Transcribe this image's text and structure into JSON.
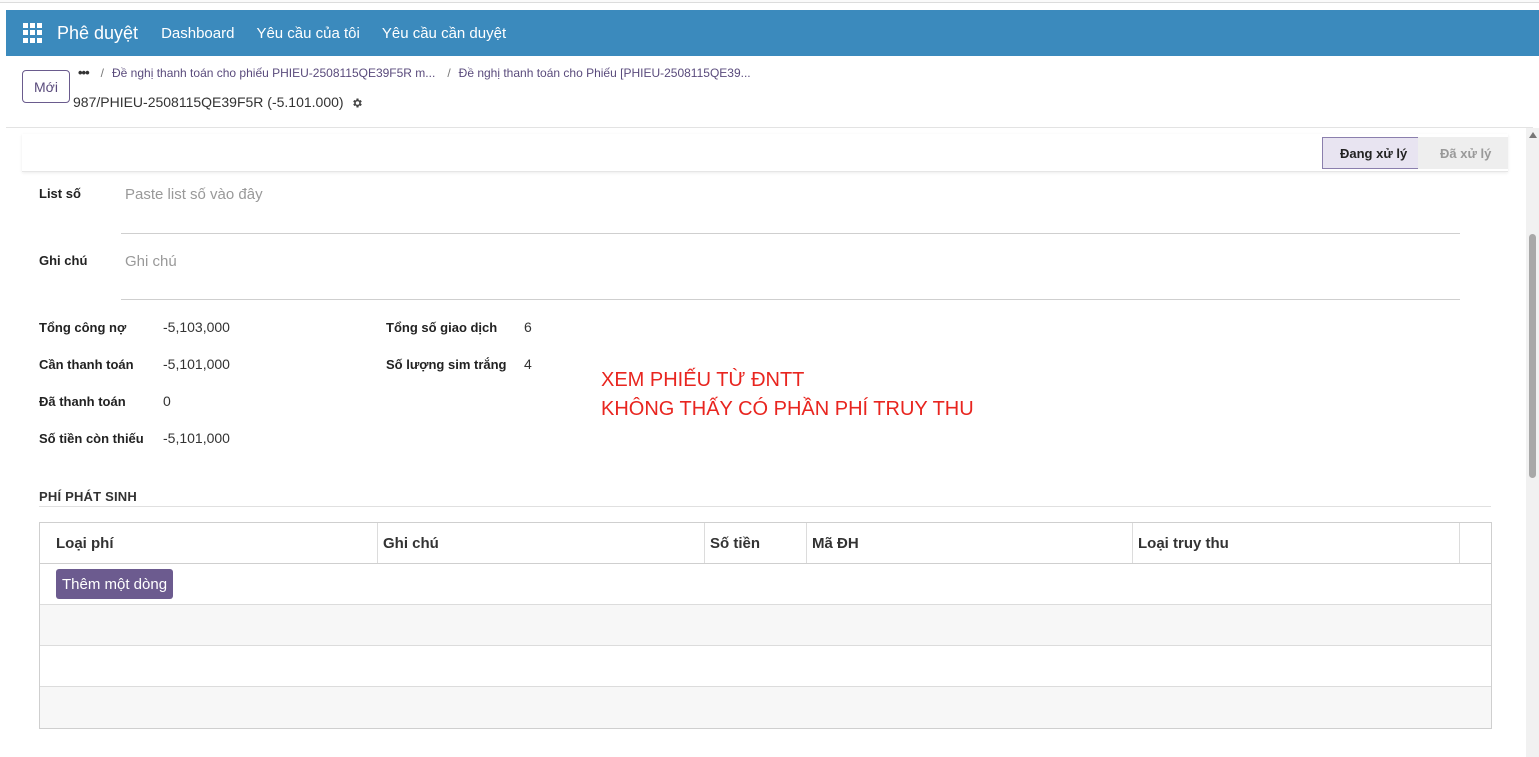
{
  "navbar": {
    "brand": "Phê duyệt",
    "items": [
      "Dashboard",
      "Yêu cầu của tôi",
      "Yêu cầu cần duyệt"
    ]
  },
  "control_panel": {
    "new_button": "Mới",
    "breadcrumbs": [
      "Đề nghị thanh toán cho phiếu PHIEU-2508115QE39F5R m...",
      "Đề nghị thanh toán cho Phiếu [PHIEU-2508115QE39..."
    ],
    "record_title": "987/PHIEU-2508115QE39F5R (-5.101.000)"
  },
  "statusbar": {
    "stages": [
      "Đang xử lý",
      "Đã xử lý"
    ],
    "active": "Đang xử lý"
  },
  "form": {
    "list_so": {
      "label": "List số",
      "placeholder": "Paste list số vào đây"
    },
    "ghi_chu": {
      "label": "Ghi chú",
      "placeholder": "Ghi chú"
    },
    "left_fields": [
      {
        "label": "Tổng công nợ",
        "value": "-5,103,000"
      },
      {
        "label": "Cần thanh toán",
        "value": "-5,101,000"
      },
      {
        "label": "Đã thanh toán",
        "value": "0"
      },
      {
        "label": "Số tiền còn thiếu",
        "value": "-5,101,000"
      }
    ],
    "right_fields": [
      {
        "label": "Tổng số giao dịch",
        "value": "6"
      },
      {
        "label": "Số lượng sim trắng",
        "value": "4"
      }
    ]
  },
  "annotation": {
    "line1": "XEM PHIẾU TỪ ĐNTT",
    "line2": "KHÔNG THẤY CÓ PHẦN PHÍ TRUY THU"
  },
  "fees_section": {
    "title": "PHÍ PHÁT SINH",
    "columns": [
      "Loại phí",
      "Ghi chú",
      "Số tiền",
      "Mã ĐH",
      "Loại truy thu"
    ],
    "add_line": "Thêm một dòng"
  },
  "icons": [
    "apps-grid-icon",
    "gear-icon",
    "ellipsis-icon"
  ],
  "colors": {
    "navbar": "#3b8abd",
    "primary": "#6c5b8f",
    "annotation": "#e8251f"
  }
}
